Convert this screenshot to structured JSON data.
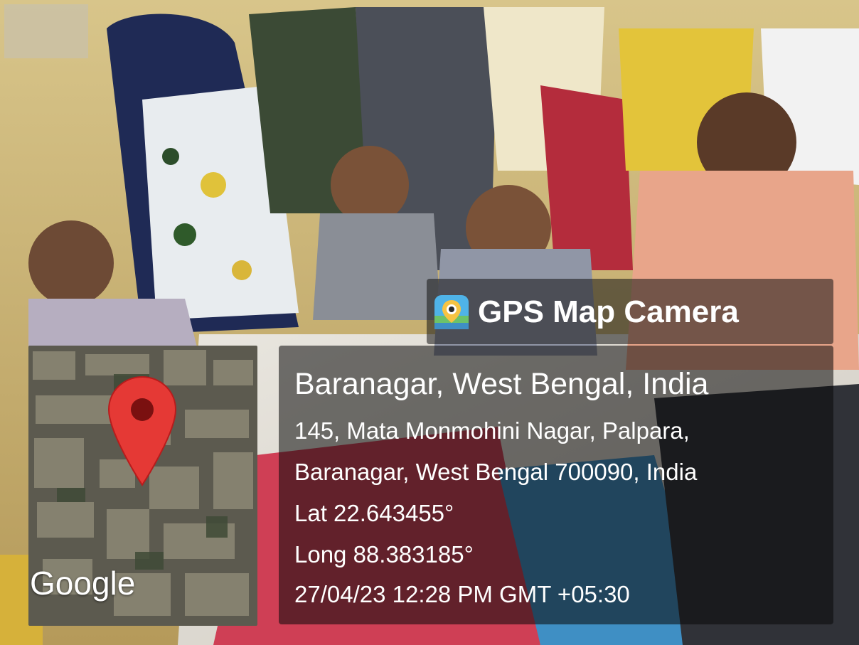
{
  "watermark": {
    "app_name": "GPS Map Camera",
    "app_icon": "gps-map-camera-app-icon",
    "map_logo": "Google",
    "pin_icon": "location-pin-icon",
    "place_title": "Baranagar, West Bengal, India",
    "address_line_1": "145, Mata Monmohini Nagar, Palpara,",
    "address_line_2": "Baranagar, West Bengal 700090, India",
    "latitude": "Lat 22.643455°",
    "longitude": "Long 88.383185°",
    "datetime": "27/04/23 12:28 PM GMT +05:30"
  },
  "colors": {
    "panel_bg": "#141414",
    "text": "#ffffff",
    "pin": "#e53935",
    "pin_center": "#7a1010"
  }
}
